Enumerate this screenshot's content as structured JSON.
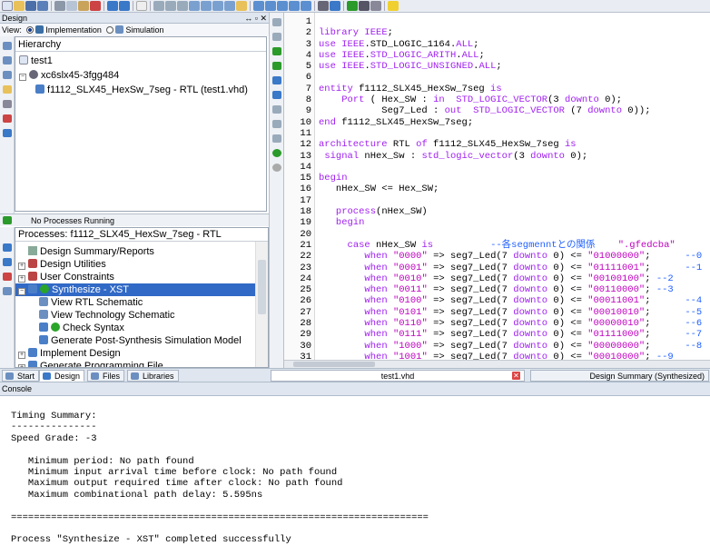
{
  "design_panel": {
    "title": "Design",
    "view_label": "View:",
    "impl_label": "Implementation",
    "sim_label": "Simulation",
    "hierarchy_title": "Hierarchy",
    "tree": [
      "test1",
      "xc6slx45-3fgg484",
      "f1112_SLX45_HexSw_7seg - RTL (test1.vhd)"
    ]
  },
  "processes": {
    "status": "No Processes Running",
    "title": "Processes: f1112_SLX45_HexSw_7seg - RTL",
    "items": [
      "Design Summary/Reports",
      "Design Utilities",
      "User Constraints",
      "Synthesize - XST",
      "View RTL Schematic",
      "View Technology Schematic",
      "Check Syntax",
      "Generate Post-Synthesis Simulation Model",
      "Implement Design",
      "Generate Programming File"
    ],
    "selected": "Synthesize - XST"
  },
  "bottom_tabs": [
    "Start",
    "Design",
    "Files",
    "Libraries"
  ],
  "editor_tabs": [
    "test1.vhd",
    "Design Summary (Synthesized)"
  ],
  "editor": {
    "line_numbers": [
      "1",
      "2",
      "3",
      "4",
      "5",
      "6",
      "7",
      "8",
      "9",
      "10",
      "11",
      "12",
      "13",
      "14",
      "15",
      "16",
      "17",
      "18",
      "19",
      "20",
      "21",
      "22",
      "23",
      "24",
      "25",
      "26",
      "27",
      "28",
      "29",
      "30",
      "31"
    ],
    "code": [
      "",
      "library IEEE;",
      "use IEEE.STD_LOGIC_1164.ALL;",
      "use IEEE.STD_LOGIC_ARITH.ALL;",
      "use IEEE.STD_LOGIC_UNSIGNED.ALL;",
      "",
      "entity f1112_SLX45_HexSw_7seg is",
      "    Port ( Hex_SW : in  STD_LOGIC_VECTOR(3 downto 0);",
      "           Seg7_Led : out  STD_LOGIC_VECTOR (7 downto 0));",
      "end f1112_SLX45_HexSw_7seg;",
      "",
      "architecture RTL of f1112_SLX45_HexSw_7seg is",
      " signal nHex_Sw : std_logic_vector(3 downto 0);",
      "",
      "begin",
      "   nHex_SW <= Hex_SW;",
      "",
      "   process(nHex_SW)",
      "   begin",
      "",
      "     case nHex_SW is          --各segmenntとの関係    \".gfedcba\"",
      "        when \"0000\" => seg7_Led(7 downto 0) <= \"01000000\";      --0",
      "        when \"0001\" => seg7_Led(7 downto 0) <= \"01111001\";      --1",
      "        when \"0010\" => seg7_Led(7 downto 0) <= \"00100100\"; --2",
      "        when \"0011\" => seg7_Led(7 downto 0) <= \"00110000\"; --3",
      "        when \"0100\" => seg7_Led(7 downto 0) <= \"00011001\";      --4",
      "        when \"0101\" => seg7_Led(7 downto 0) <= \"00010010\";      --5",
      "        when \"0110\" => seg7_Led(7 downto 0) <= \"00000010\";      --6",
      "        when \"0111\" => seg7_Led(7 downto 0) <= \"01111000\";      --7",
      "        when \"1000\" => seg7_Led(7 downto 0) <= \"00000000\";      --8",
      "        when \"1001\" => seg7_Led(7 downto 0) <= \"00010000\"; --9"
    ]
  },
  "console": {
    "title": "Console",
    "lines": [
      "Timing Summary:",
      "---------------",
      "Speed Grade: -3",
      "",
      "   Minimum period: No path found",
      "   Minimum input arrival time before clock: No path found",
      "   Maximum output required time after clock: No path found",
      "   Maximum combinational path delay: 5.595ns",
      "",
      "=========================================================================",
      "",
      "Process \"Synthesize - XST\" completed successfully"
    ]
  },
  "colors": {
    "selection": "#3169c6",
    "keyword": "#a020f0",
    "comment": "#2060ff",
    "string": "#c000c0",
    "panel_header": "#dfe6ef"
  }
}
